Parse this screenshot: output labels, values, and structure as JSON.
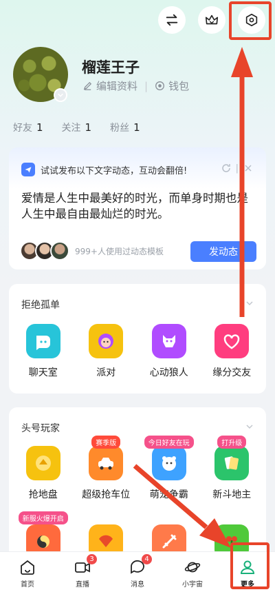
{
  "header": {
    "buttons": [
      {
        "name": "switch-icon"
      },
      {
        "name": "crown-icon"
      },
      {
        "name": "settings-hexagon-icon"
      }
    ]
  },
  "profile": {
    "username": "榴莲王子",
    "edit_label": "编辑资料",
    "wallet_label": "钱包"
  },
  "stats": [
    {
      "label": "好友",
      "value": "1"
    },
    {
      "label": "关注",
      "value": "1"
    },
    {
      "label": "粉丝",
      "value": "1"
    }
  ],
  "dynamic_card": {
    "prompt": "试试发布以下文字动态，互动会翻倍!",
    "text": "爱情是人生中最美好的时光，而单身时期也是人生中最自由最灿烂的时光。",
    "usage": "999+人使用过动态模板",
    "post_button": "发动态"
  },
  "section_social": {
    "title": "拒绝孤单",
    "apps": [
      {
        "label": "聊天室",
        "icon": "chat-room-icon",
        "color": "#27c4d9"
      },
      {
        "label": "派对",
        "icon": "party-icon",
        "color": "#f6c20f"
      },
      {
        "label": "心动狼人",
        "icon": "wolf-icon",
        "color": "#b04cff"
      },
      {
        "label": "缘分交友",
        "icon": "heart-icon",
        "color": "#ff3d7f"
      }
    ]
  },
  "section_games": {
    "title": "头号玩家",
    "apps": [
      {
        "label": "抢地盘",
        "icon": "territory-icon",
        "color": "#f6c20f",
        "tag": ""
      },
      {
        "label": "超级抢车位",
        "icon": "car-icon",
        "color": "#ff8a2b",
        "tag": "赛季版"
      },
      {
        "label": "萌宠争霸",
        "icon": "pet-icon",
        "color": "#3ea2ff",
        "tag": "今日好友在玩"
      },
      {
        "label": "新斗地主",
        "icon": "cards-icon",
        "color": "#2bc46b",
        "tag": "打升级"
      }
    ],
    "apps_row2": [
      {
        "icon": "fortune-icon",
        "color": "#ff6a3d",
        "tag": "新服火爆开启"
      },
      {
        "icon": "fan-icon",
        "color": "#ffb31a",
        "tag": ""
      },
      {
        "icon": "sword-icon",
        "color": "#ff7a4a",
        "tag": ""
      },
      {
        "icon": "plant-icon",
        "color": "#4fc93a",
        "tag": ""
      }
    ]
  },
  "tabbar": [
    {
      "label": "首页",
      "icon": "home-icon",
      "badge": ""
    },
    {
      "label": "直播",
      "icon": "live-icon",
      "badge": "3"
    },
    {
      "label": "消息",
      "icon": "message-icon",
      "badge": "4"
    },
    {
      "label": "小宇宙",
      "icon": "planet-icon",
      "badge": ""
    },
    {
      "label": "更多",
      "icon": "more-user-icon",
      "badge": ""
    }
  ],
  "colors": {
    "accent": "#4a7fff",
    "annotation": "#e8442a",
    "active_tab": "#19b07a"
  }
}
